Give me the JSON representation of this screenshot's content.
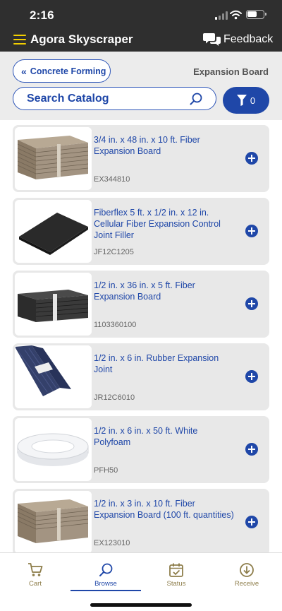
{
  "status_bar": {
    "time": "2:16"
  },
  "header": {
    "title": "Agora Skyscraper",
    "feedback_label": "Feedback"
  },
  "nav": {
    "back_label": "Concrete Forming",
    "current_category": "Expansion Board"
  },
  "search": {
    "placeholder": "Search Catalog",
    "value": ""
  },
  "filter": {
    "count": "0"
  },
  "products": [
    {
      "name": "3/4 in. x 48 in. x 10 ft. Fiber Expansion Board",
      "sku": "EX344810",
      "image": "fiber-board-stack"
    },
    {
      "name": "Fiberflex 5 ft. x 1/2 in. x 12 in. Cellular Fiber Expansion Control Joint Filler",
      "sku": "JF12C1205",
      "image": "fiberflex-sheet"
    },
    {
      "name": "1/2 in. x 36 in. x 5 ft. Fiber Expansion Board",
      "sku": "1103360100",
      "image": "black-board-bundle"
    },
    {
      "name": "1/2 in. x 6 in. Rubber Expansion Joint",
      "sku": "JR12C6010",
      "image": "rubber-joint-bundle"
    },
    {
      "name": "1/2 in. x 6 in. x 50 ft. White Polyfoam",
      "sku": "PFH50",
      "image": "polyfoam-roll"
    },
    {
      "name": "1/2 in. x 3 in. x 10 ft. Fiber Expansion Board (100 ft. quantities)",
      "sku": "EX123010",
      "image": "fiber-board-stack"
    }
  ],
  "tabs": [
    {
      "label": "Cart",
      "icon": "cart-icon",
      "active": false
    },
    {
      "label": "Browse",
      "icon": "search-icon",
      "active": true
    },
    {
      "label": "Status",
      "icon": "calendar-check-icon",
      "active": false
    },
    {
      "label": "Receive",
      "icon": "download-circle-icon",
      "active": false
    }
  ],
  "colors": {
    "brand_blue": "#1f47a8",
    "header_dark": "#2f2f2f",
    "menu_yellow": "#f3cf00",
    "tab_inactive": "#8d7d4a"
  }
}
